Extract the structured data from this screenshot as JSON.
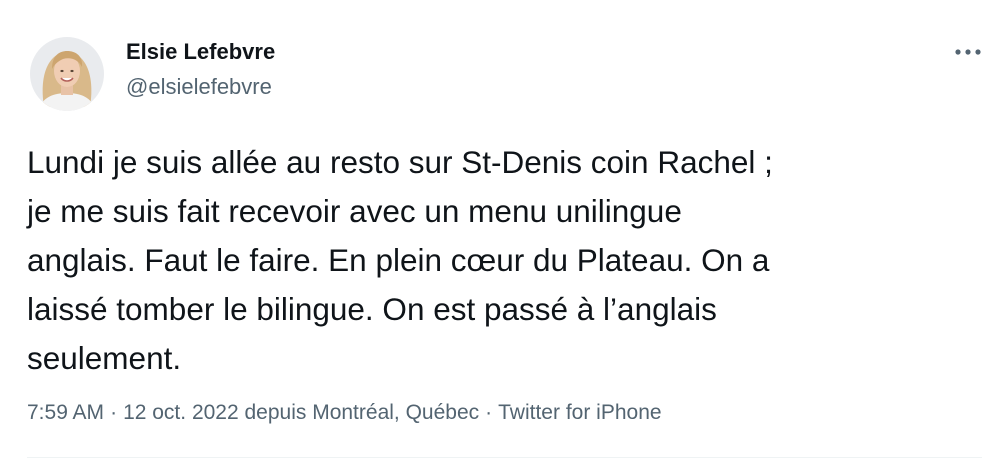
{
  "author": {
    "name": "Elsie Lefebvre",
    "handle": "@elsielefebvre"
  },
  "tweet": {
    "lines": [
      "Lundi je suis allée au resto sur St-Denis coin Rachel ;",
      "je me suis fait recevoir avec un menu unilingue",
      "anglais. Faut le faire. En plein cœur du Plateau. On a",
      "laissé tomber le bilingue. On est passé à l’anglais",
      "seulement."
    ]
  },
  "meta": {
    "time": "7:59 AM",
    "separator": "·",
    "date_location": "12 oct. 2022 depuis Montréal, Québec",
    "source": "Twitter for iPhone"
  },
  "icons": {
    "more": "more-horizontal-icon"
  },
  "colors": {
    "text_primary": "#0f1419",
    "text_secondary": "#536471",
    "divider": "#eff3f4"
  }
}
